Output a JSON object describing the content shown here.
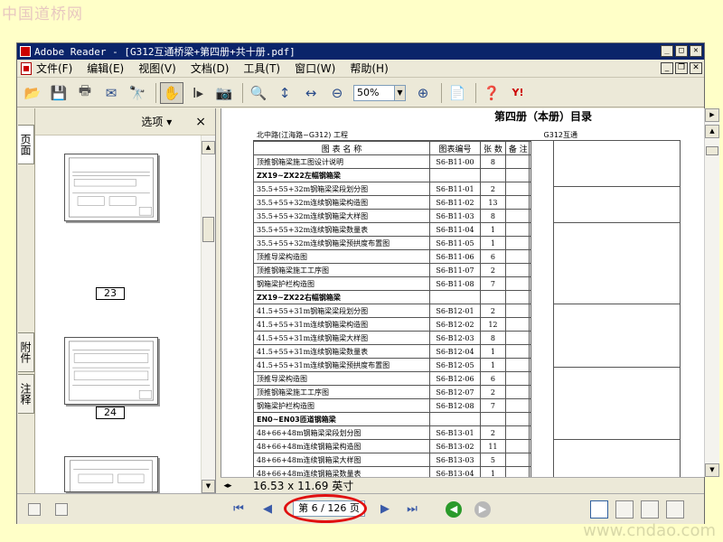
{
  "watermarks": {
    "top_left": "中国道桥网",
    "bottom_right": "www.cndao.com"
  },
  "window": {
    "title": "Adobe Reader - [G312互通桥梁+第四册+共十册.pdf]"
  },
  "menu": {
    "items": [
      "文件(F)",
      "编辑(E)",
      "视图(V)",
      "文档(D)",
      "工具(T)",
      "窗口(W)",
      "帮助(H)"
    ]
  },
  "toolbar": {
    "zoom_value": "50%",
    "icons": [
      "open-icon",
      "save-icon",
      "print-icon",
      "email-icon",
      "search-icon",
      "hand-tool-icon",
      "select-text-icon",
      "snapshot-icon",
      "zoom-in-icon",
      "fit-page-icon",
      "fit-width-icon",
      "zoom-out-icon",
      "zoom-in-plus-icon",
      "pages-icon",
      "help-icon",
      "yahoo-icon"
    ]
  },
  "side_tabs": {
    "pages": "页面",
    "attachments": "附件",
    "comments": "注释"
  },
  "thumbnails": {
    "options_label": "选项",
    "close_label": "×",
    "pages": [
      "23",
      "24",
      ""
    ]
  },
  "document": {
    "heading": "第四册（本册）目录",
    "project_left": "北中路(江海路~G312) 工程",
    "project_right": "G312互通",
    "columns": [
      "图 表 名 称",
      "图表编号",
      "张 数",
      "备 注"
    ],
    "rows": [
      {
        "name": "顶推钢箱梁施工图设计说明",
        "code": "S6-B11-00",
        "count": "8",
        "section": false
      },
      {
        "name": "ZX19~ZX22左幅钢箱梁",
        "code": "",
        "count": "",
        "section": true
      },
      {
        "name": "35.5+55+32m钢箱梁梁段划分图",
        "code": "S6-B11-01",
        "count": "2",
        "section": false
      },
      {
        "name": "35.5+55+32m连续钢箱梁构造图",
        "code": "S6-B11-02",
        "count": "13",
        "section": false
      },
      {
        "name": "35.5+55+32m连续钢箱梁大样图",
        "code": "S6-B11-03",
        "count": "8",
        "section": false
      },
      {
        "name": "35.5+55+32m连续钢箱梁数量表",
        "code": "S6-B11-04",
        "count": "1",
        "section": false
      },
      {
        "name": "35.5+55+32m连续钢箱梁预拱度布置图",
        "code": "S6-B11-05",
        "count": "1",
        "section": false
      },
      {
        "name": "顶推导梁构造图",
        "code": "S6-B11-06",
        "count": "6",
        "section": false
      },
      {
        "name": "顶推钢箱梁施工工序图",
        "code": "S6-B11-07",
        "count": "2",
        "section": false
      },
      {
        "name": "钢箱梁护栏构造图",
        "code": "S6-B11-08",
        "count": "7",
        "section": false
      },
      {
        "name": "ZX19~ZX22右幅钢箱梁",
        "code": "",
        "count": "",
        "section": true
      },
      {
        "name": "41.5+55+31m钢箱梁梁段划分图",
        "code": "S6-B12-01",
        "count": "2",
        "section": false
      },
      {
        "name": "41.5+55+31m连续钢箱梁构造图",
        "code": "S6-B12-02",
        "count": "12",
        "section": false
      },
      {
        "name": "41.5+55+31m连续钢箱梁大样图",
        "code": "S6-B12-03",
        "count": "8",
        "section": false
      },
      {
        "name": "41.5+55+31m连续钢箱梁数量表",
        "code": "S6-B12-04",
        "count": "1",
        "section": false
      },
      {
        "name": "41.5+55+31m连续钢箱梁预拱度布置图",
        "code": "S6-B12-05",
        "count": "1",
        "section": false
      },
      {
        "name": "顶推导梁构造图",
        "code": "S6-B12-06",
        "count": "6",
        "section": false
      },
      {
        "name": "顶推钢箱梁施工工序图",
        "code": "S6-B12-07",
        "count": "2",
        "section": false
      },
      {
        "name": "钢箱梁护栏构造图",
        "code": "S6-B12-08",
        "count": "7",
        "section": false
      },
      {
        "name": "EN0~EN03匝道钢箱梁",
        "code": "",
        "count": "",
        "section": true
      },
      {
        "name": "48+66+48m钢箱梁梁段划分图",
        "code": "S6-B13-01",
        "count": "2",
        "section": false
      },
      {
        "name": "48+66+48m连续钢箱梁构造图",
        "code": "S6-B13-02",
        "count": "11",
        "section": false
      },
      {
        "name": "48+66+48m连续钢箱梁大样图",
        "code": "S6-B13-03",
        "count": "5",
        "section": false
      },
      {
        "name": "48+66+48m连续钢箱梁数量表",
        "code": "S6-B13-04",
        "count": "1",
        "section": false
      }
    ]
  },
  "status": {
    "page_size": "16.53 x 11.69 英寸",
    "page_indicator": "第 6 / 126 页"
  },
  "colors": {
    "titlebar": "#0a246a",
    "highlight_oval": "#e01010",
    "background": "#ffffc8"
  }
}
